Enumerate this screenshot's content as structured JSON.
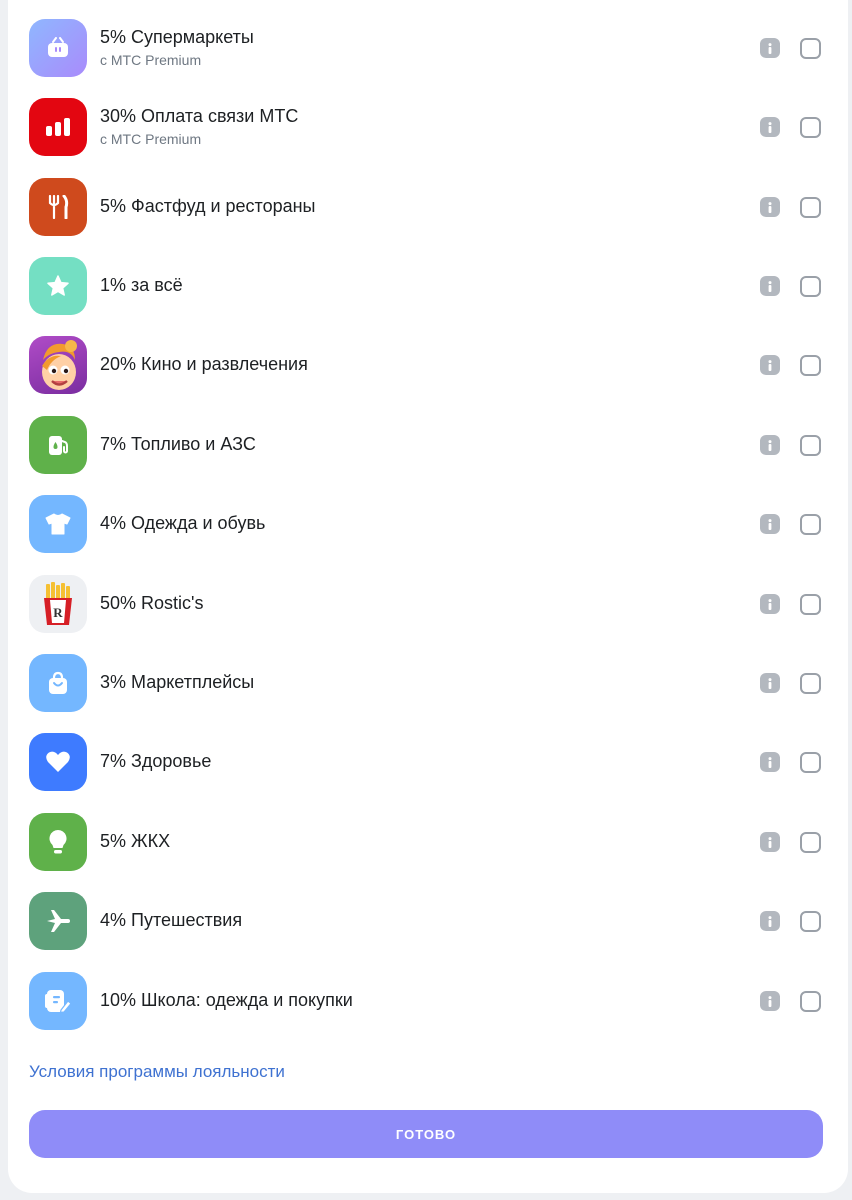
{
  "categories": [
    {
      "label": "5% Супермаркеты",
      "sublabel": "с МТС Premium",
      "icon": "shopping-basket-icon",
      "color": "#9b8cfb"
    },
    {
      "label": "30% Оплата связи МТС",
      "sublabel": "с МТС Premium",
      "icon": "bar-chart-icon",
      "color": "#e30611"
    },
    {
      "label": "5% Фастфуд и рестораны",
      "icon": "fork-knife-icon",
      "color": "#cf4a1d"
    },
    {
      "label": "1% за всё",
      "icon": "star-icon",
      "color": "#74dfc3"
    },
    {
      "label": "20% Кино и развлечения",
      "icon": "cartoon-character-icon",
      "color": "#8e3db5"
    },
    {
      "label": "7% Топливо и АЗС",
      "icon": "fuel-pump-icon",
      "color": "#5fb14a"
    },
    {
      "label": "4% Одежда и обувь",
      "icon": "t-shirt-icon",
      "color": "#74b7ff"
    },
    {
      "label": "50% Rostic's",
      "icon": "rostics-fries-icon",
      "color": "#eef0f3"
    },
    {
      "label": "3% Маркетплейсы",
      "icon": "shopping-bag-icon",
      "color": "#74b7ff"
    },
    {
      "label": "7% Здоровье",
      "icon": "heart-icon",
      "color": "#3e7bff"
    },
    {
      "label": "5% ЖКХ",
      "icon": "light-bulb-icon",
      "color": "#5fb14a"
    },
    {
      "label": "4% Путешествия",
      "icon": "airplane-icon",
      "color": "#5ea27c"
    },
    {
      "label": "10% Школа: одежда и покупки",
      "icon": "notebook-pen-icon",
      "color": "#74b7ff"
    }
  ],
  "terms_link": "Условия программы лояльности",
  "done_button": "ГОТОВО",
  "colors": {
    "primary_button": "#8f8cf8",
    "link": "#3f72d1",
    "info_icon": "#b3b8bf",
    "checkbox_border": "#9aa0a8"
  }
}
